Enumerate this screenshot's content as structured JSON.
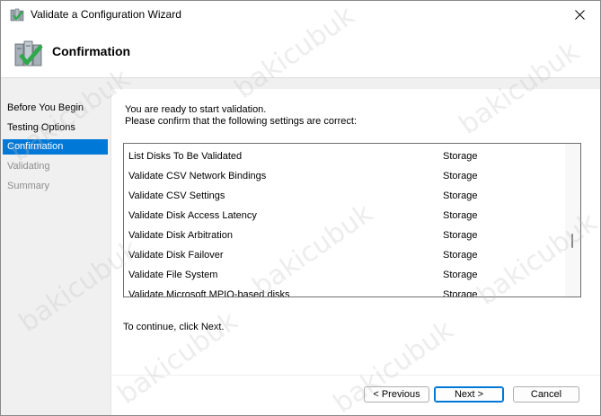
{
  "window": {
    "title": "Validate a Configuration Wizard"
  },
  "header": {
    "title": "Confirmation"
  },
  "sidebar": {
    "items": [
      {
        "label": "Before You Begin",
        "state": "normal"
      },
      {
        "label": "Testing Options",
        "state": "normal"
      },
      {
        "label": "Confirmation",
        "state": "active"
      },
      {
        "label": "Validating",
        "state": "disabled"
      },
      {
        "label": "Summary",
        "state": "disabled"
      }
    ]
  },
  "main": {
    "intro_line1": "You are ready to start validation.",
    "intro_line2": "Please confirm that the following settings are correct:",
    "tests": [
      {
        "name": "List Disks To Be Validated",
        "category": "Storage"
      },
      {
        "name": "Validate CSV Network Bindings",
        "category": "Storage"
      },
      {
        "name": "Validate CSV Settings",
        "category": "Storage"
      },
      {
        "name": "Validate Disk Access Latency",
        "category": "Storage"
      },
      {
        "name": "Validate Disk Arbitration",
        "category": "Storage"
      },
      {
        "name": "Validate Disk Failover",
        "category": "Storage"
      },
      {
        "name": "Validate File System",
        "category": "Storage"
      },
      {
        "name": "Validate Microsoft MPIO-based disks",
        "category": "Storage"
      }
    ],
    "continue_text": "To continue, click Next."
  },
  "buttons": {
    "previous": "< Previous",
    "next": "Next >",
    "cancel": "Cancel"
  },
  "watermark": "bakicubuk",
  "colors": {
    "selection": "#0078d7",
    "check": "#2ea84a"
  }
}
